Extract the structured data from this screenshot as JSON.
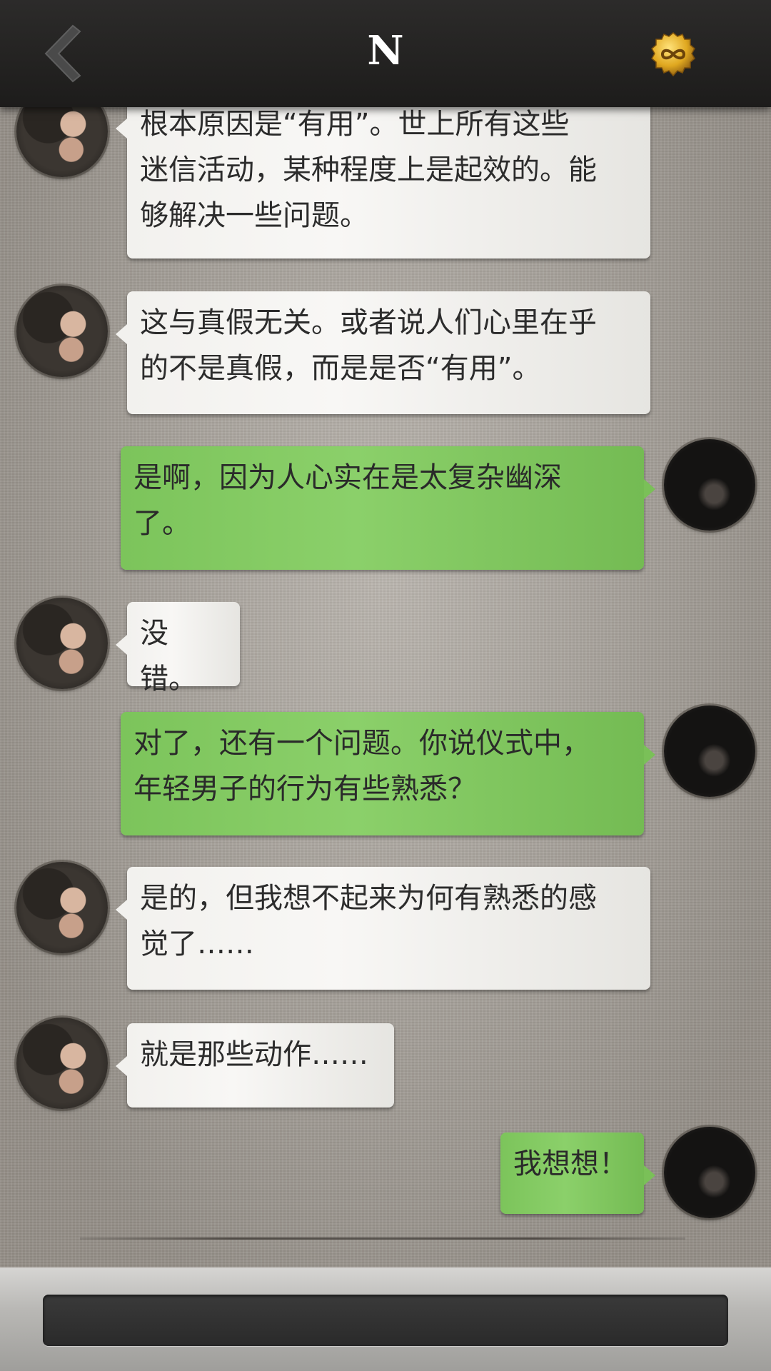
{
  "header": {
    "title": "N",
    "back_icon": "chevron-left-icon",
    "coin_icon": "infinity-coin-icon"
  },
  "messages": [
    {
      "sender": "other",
      "text": "根本原因是“有用”。世上所有这些\n迷信活动，某种程度上是起效的。能\n够解决一些问题。"
    },
    {
      "sender": "other",
      "text": "这与真假无关。或者说人们心里在乎\n的不是真假，而是是否“有用”。"
    },
    {
      "sender": "self",
      "text": "是啊，因为人心实在是太复杂幽深\n了。"
    },
    {
      "sender": "other",
      "text": "没错。"
    },
    {
      "sender": "self",
      "text": "对了，还有一个问题。你说仪式中，\n年轻男子的行为有些熟悉？"
    },
    {
      "sender": "other",
      "text": "是的，但我想不起来为何有熟悉的感\n觉了……"
    },
    {
      "sender": "other",
      "text": "就是那些动作……"
    },
    {
      "sender": "self",
      "text": "我想想！"
    }
  ],
  "composer": {
    "value": ""
  },
  "colors": {
    "header_bg": "#1d1c1b",
    "self_bubble": "#7cc45b",
    "other_bubble": "#f2f1ee",
    "background": "#aaa49c"
  }
}
